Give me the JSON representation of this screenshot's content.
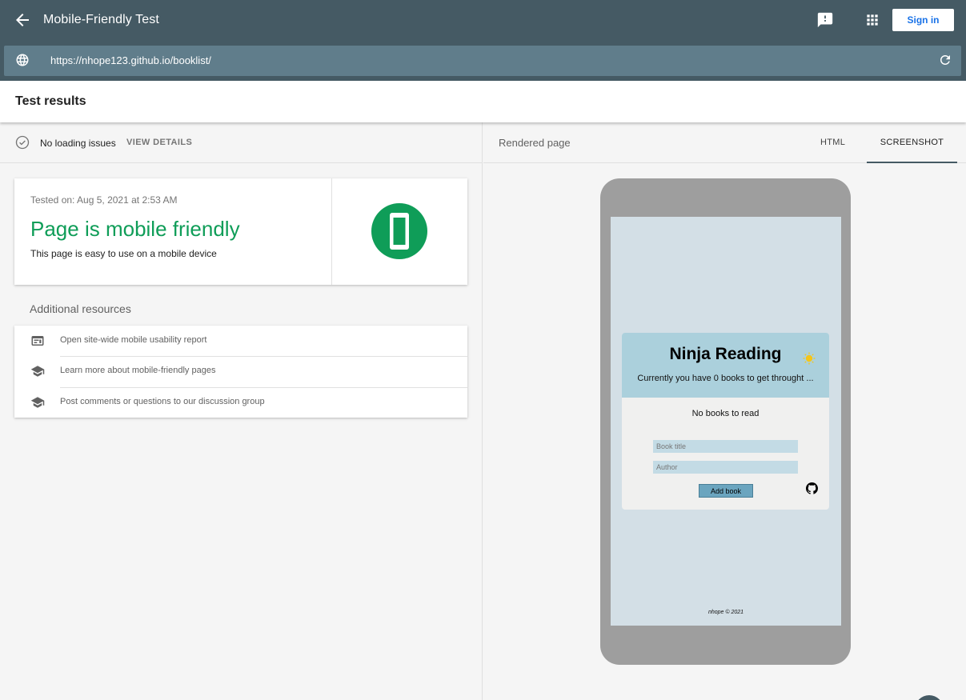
{
  "header": {
    "title": "Mobile-Friendly Test",
    "sign_in": "Sign in",
    "url": "https://nhope123.github.io/booklist/",
    "back_icon": "arrow-back-icon",
    "feedback_icon": "feedback-icon",
    "apps_icon": "apps-grid-icon"
  },
  "results": {
    "title": "Test results"
  },
  "status": {
    "text": "No loading issues",
    "view_details": "VIEW DETAILS"
  },
  "result_card": {
    "tested_on": "Tested on: Aug 5, 2021 at 2:53 AM",
    "headline": "Page is mobile friendly",
    "subtitle": "This page is easy to use on a mobile device",
    "accent": "#0f9d58"
  },
  "resources": {
    "heading": "Additional resources",
    "items": [
      {
        "label": "Open site-wide mobile usability report",
        "icon": "report-icon"
      },
      {
        "label": "Learn more about mobile-friendly pages",
        "icon": "school-icon"
      },
      {
        "label": "Post comments or questions to our discussion group",
        "icon": "school-icon"
      }
    ]
  },
  "rendered": {
    "title": "Rendered page",
    "tabs": [
      "HTML",
      "SCREENSHOT"
    ],
    "active_tab": "SCREENSHOT"
  },
  "phone": {
    "app_title": "Ninja Reading",
    "subtitle": "Currently you have 0 books to get throught ...",
    "empty": "No books to read",
    "title_placeholder": "Book title",
    "author_placeholder": "Author",
    "add_button": "Add book",
    "footer": "nhope © 2021"
  },
  "colors": {
    "header_bg": "#455a64",
    "urlbar_bg": "#607d8b",
    "success": "#0f9d58",
    "link_blue": "#1a73e8"
  }
}
